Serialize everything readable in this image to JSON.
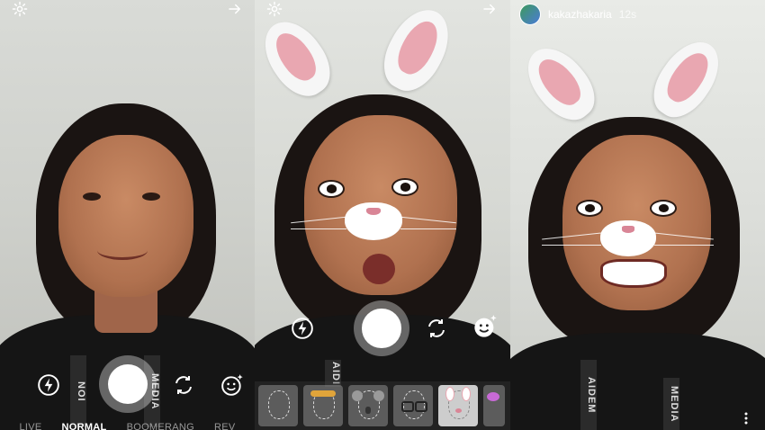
{
  "panel1": {
    "settings_icon": "gear-icon",
    "forward_icon": "arrow-right-icon",
    "modes": [
      "LIVE",
      "NORMAL",
      "BOOMERANG",
      "REV"
    ],
    "active_mode_index": 1,
    "lanyard_text": "MEDIA",
    "lanyard_text_2": "NOI"
  },
  "panel2": {
    "settings_icon": "gear-icon",
    "forward_icon": "arrow-right-icon",
    "lanyard_text": "AIDI",
    "filters": [
      "none",
      "flower-crown",
      "koala",
      "glasses",
      "bunny",
      "butterfly"
    ],
    "selected_filter_index": 4
  },
  "panel3": {
    "username": "kakazhakaria",
    "timestamp": "12s",
    "lanyard_text": "AIDEM",
    "lanyard_text_2": "MEDIA",
    "more_icon": "more-vertical-icon"
  },
  "icons": {
    "flash": "⚡",
    "switch_camera": "↻",
    "face_filter": "☺",
    "settings": "⚙",
    "arrow": "→",
    "more": "⋮"
  }
}
